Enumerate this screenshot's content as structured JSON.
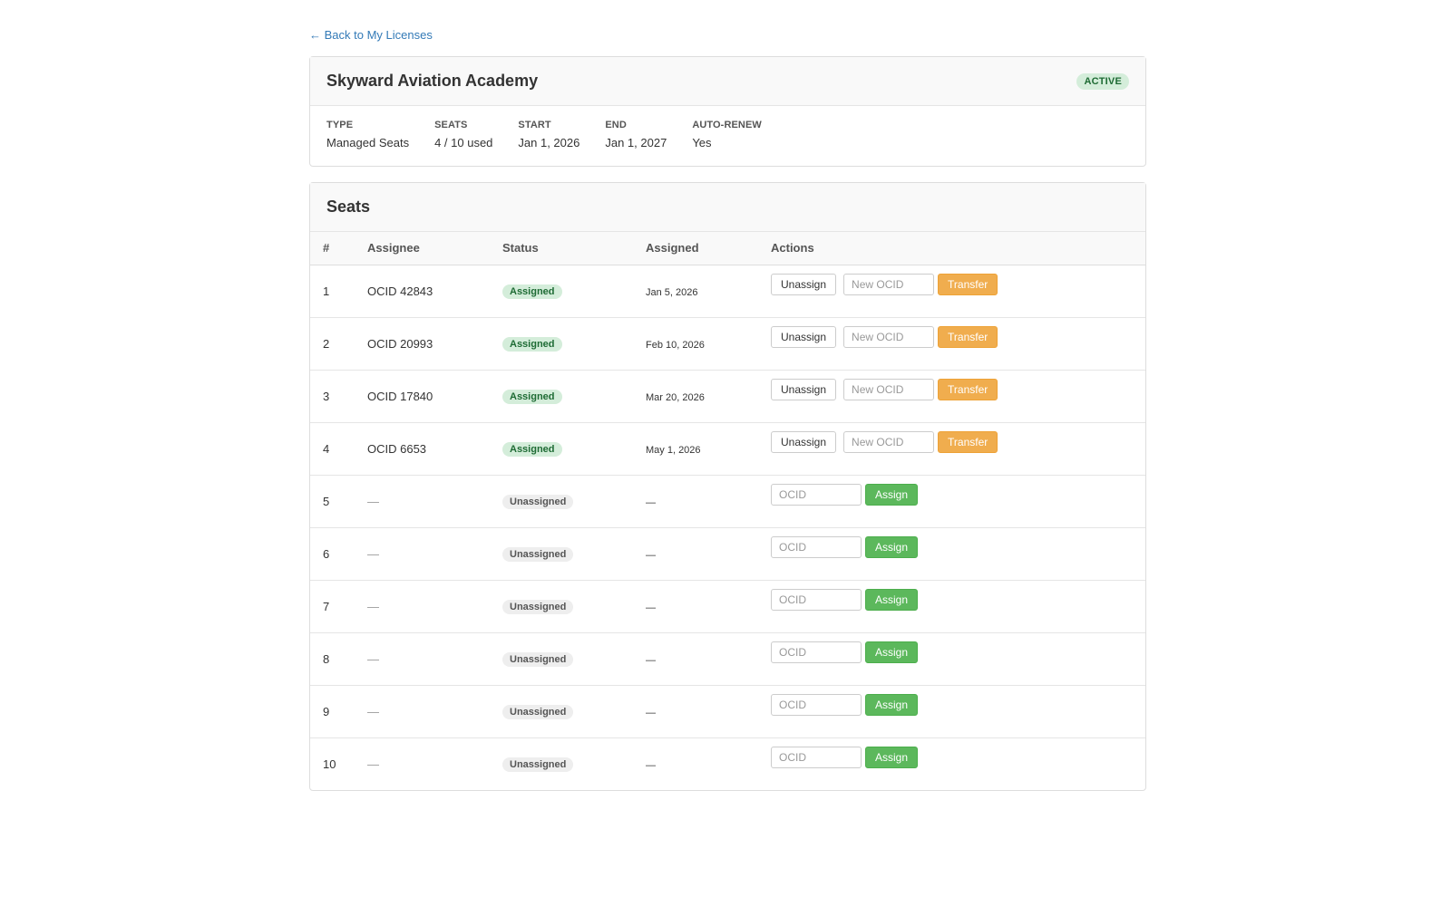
{
  "nav": {
    "back_label": "← Back to My Licenses"
  },
  "license": {
    "name": "Skyward Aviation Academy",
    "status": "ACTIVE",
    "meta": [
      {
        "label": "TYPE",
        "value": "Managed Seats"
      },
      {
        "label": "SEATS",
        "value": "4 / 10 used"
      },
      {
        "label": "START",
        "value": "Jan 1, 2026"
      },
      {
        "label": "END",
        "value": "Jan 1, 2027"
      },
      {
        "label": "AUTO-RENEW",
        "value": "Yes"
      }
    ]
  },
  "seats": {
    "title": "Seats",
    "columns": [
      "#",
      "Assignee",
      "Status",
      "Assigned",
      "Actions"
    ],
    "rows": [
      {
        "num": "1",
        "assignee": "OCID 42843",
        "status": "Assigned",
        "assigned": "Jan 5, 2026"
      },
      {
        "num": "2",
        "assignee": "OCID 20993",
        "status": "Assigned",
        "assigned": "Feb 10, 2026"
      },
      {
        "num": "3",
        "assignee": "OCID 17840",
        "status": "Assigned",
        "assigned": "Mar 20, 2026"
      },
      {
        "num": "4",
        "assignee": "OCID 6653",
        "status": "Assigned",
        "assigned": "May 1, 2026"
      },
      {
        "num": "5",
        "assignee": "—",
        "status": "Unassigned",
        "assigned": "—"
      },
      {
        "num": "6",
        "assignee": "—",
        "status": "Unassigned",
        "assigned": "—"
      },
      {
        "num": "7",
        "assignee": "—",
        "status": "Unassigned",
        "assigned": "—"
      },
      {
        "num": "8",
        "assignee": "—",
        "status": "Unassigned",
        "assigned": "—"
      },
      {
        "num": "9",
        "assignee": "—",
        "status": "Unassigned",
        "assigned": "—"
      },
      {
        "num": "10",
        "assignee": "—",
        "status": "Unassigned",
        "assigned": "—"
      }
    ],
    "actions": {
      "unassign_label": "Unassign",
      "new_ocid_placeholder": "New OCID",
      "transfer_label": "Transfer",
      "ocid_placeholder": "OCID",
      "assign_label": "Assign"
    }
  },
  "colors": {
    "link": "#337ab7",
    "assigned_badge_bg": "#d4edda",
    "unassigned_badge_bg": "#eeeeee",
    "transfer_button": "#f0ad4e",
    "assign_button": "#5cb85c"
  }
}
